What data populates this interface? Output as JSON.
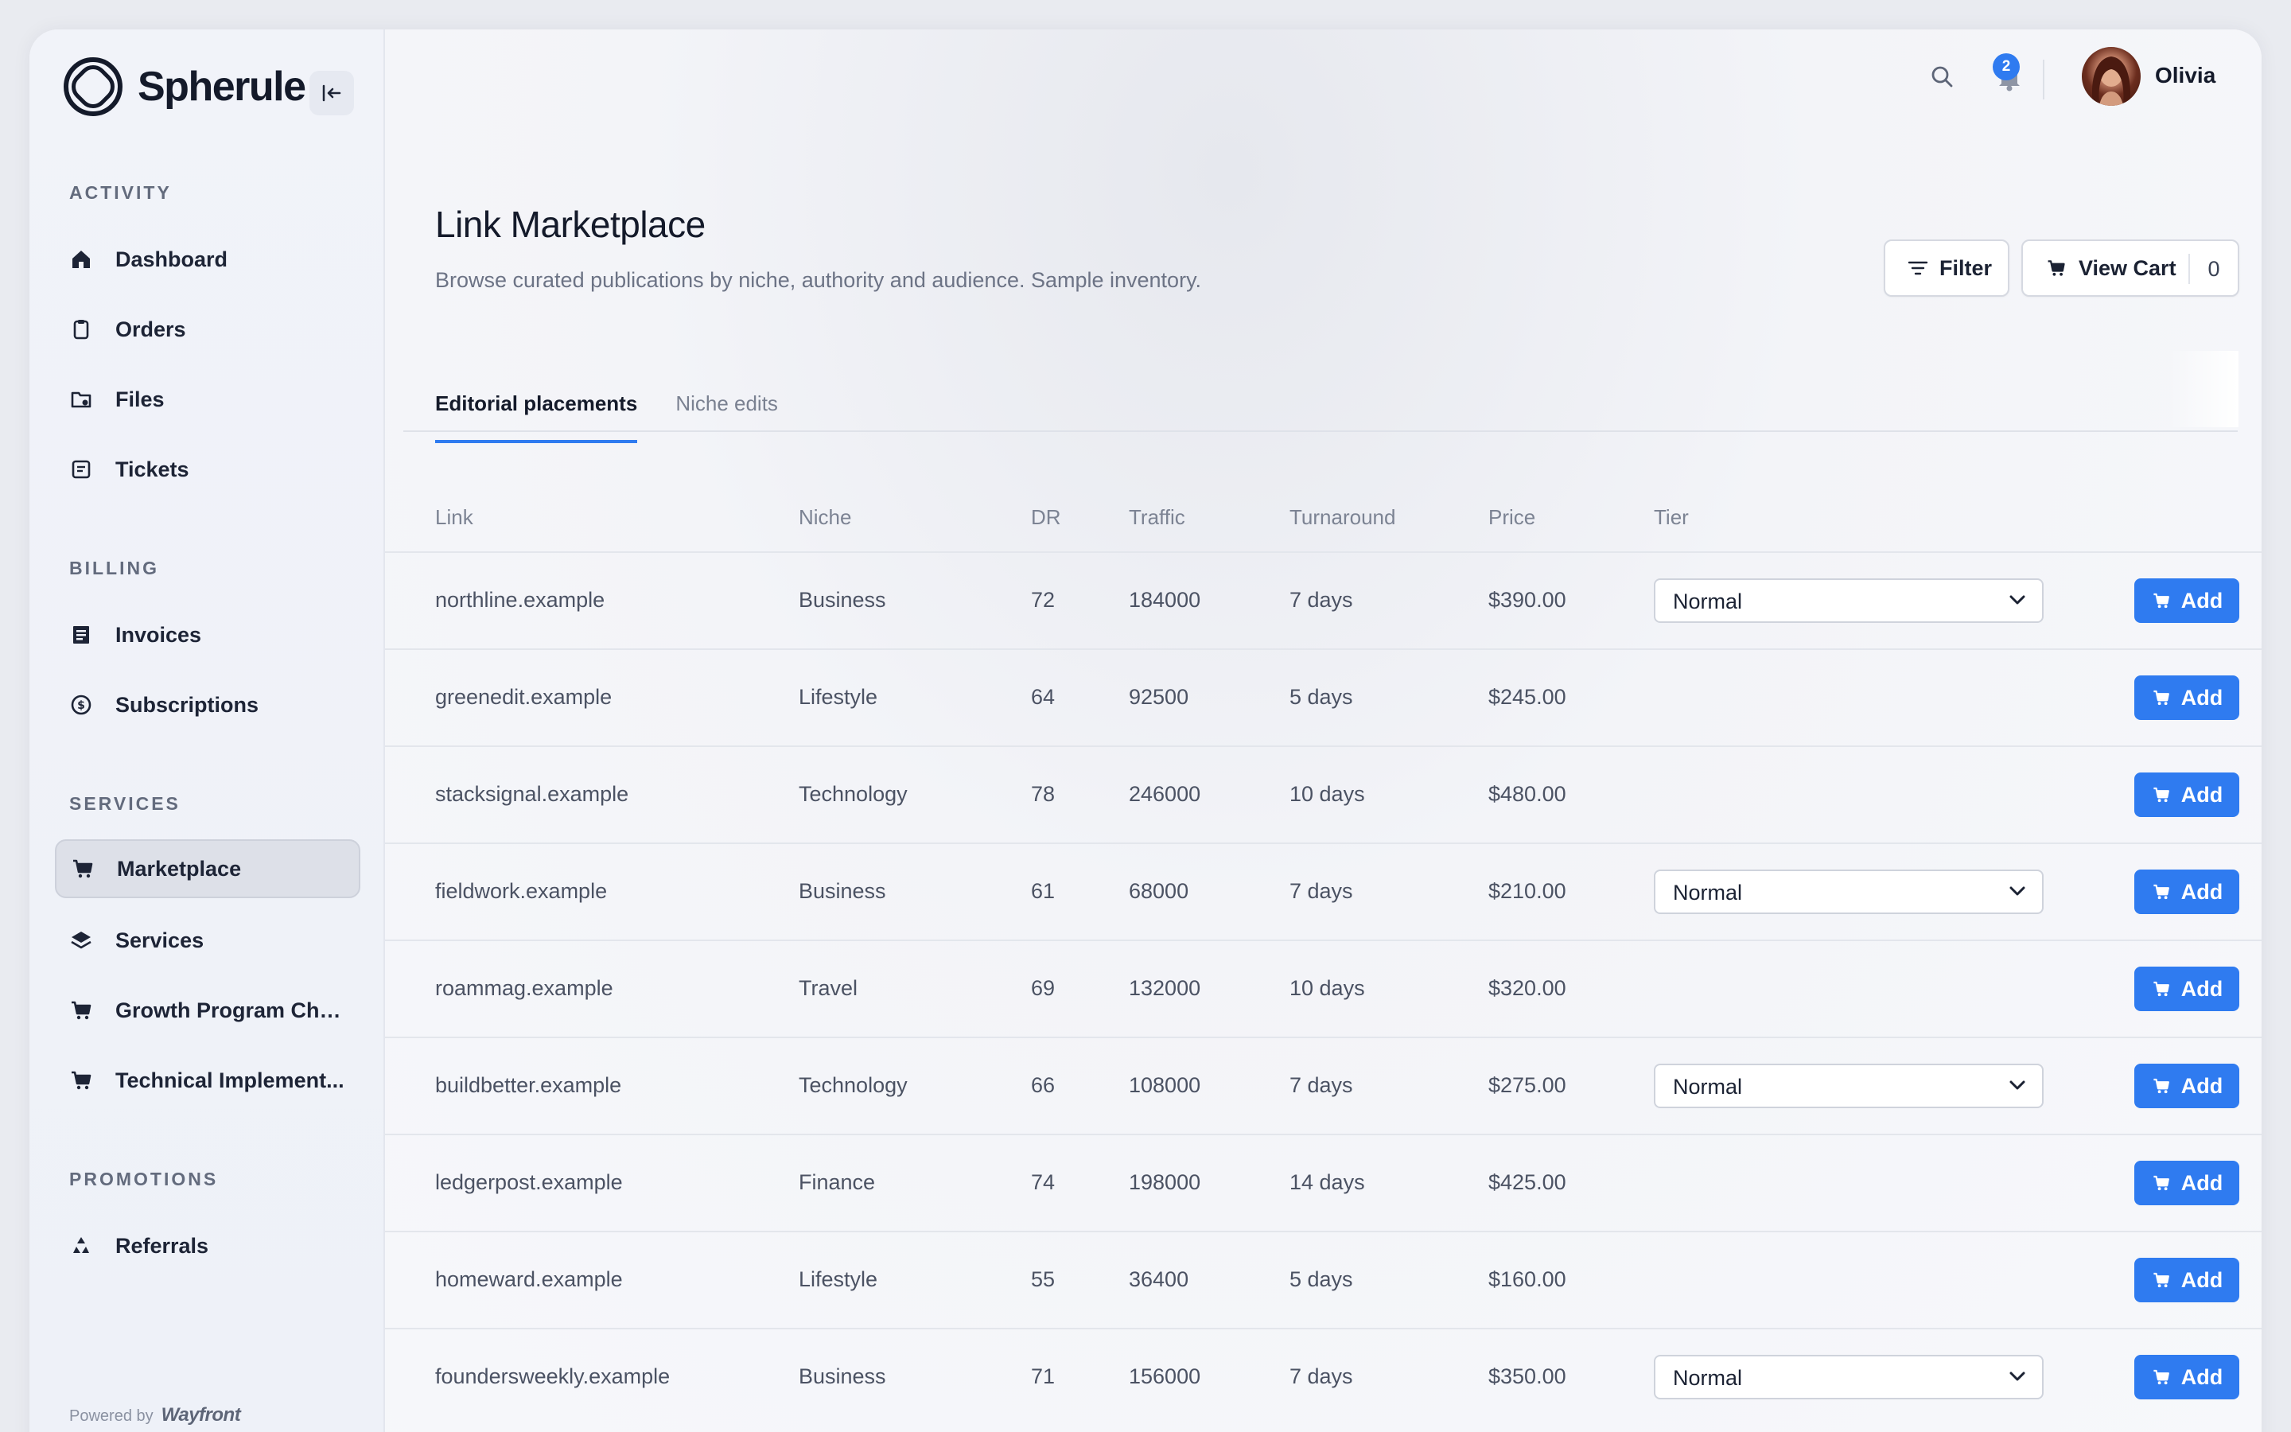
{
  "brand": {
    "name": "Spherule"
  },
  "sidebar": {
    "sections": [
      {
        "label": "ACTIVITY",
        "items": [
          {
            "label": "Dashboard",
            "icon": "home-icon"
          },
          {
            "label": "Orders",
            "icon": "clipboard-icon"
          },
          {
            "label": "Files",
            "icon": "folder-icon"
          },
          {
            "label": "Tickets",
            "icon": "ticket-icon"
          }
        ]
      },
      {
        "label": "BILLING",
        "items": [
          {
            "label": "Invoices",
            "icon": "invoice-icon"
          },
          {
            "label": "Subscriptions",
            "icon": "subscription-icon"
          }
        ]
      },
      {
        "label": "SERVICES",
        "items": [
          {
            "label": "Marketplace",
            "icon": "cart-icon",
            "active": true
          },
          {
            "label": "Services",
            "icon": "layers-icon"
          },
          {
            "label": "Growth Program Che...",
            "icon": "cart-icon"
          },
          {
            "label": "Technical Implement...",
            "icon": "cart-icon"
          }
        ]
      },
      {
        "label": "PROMOTIONS",
        "items": [
          {
            "label": "Referrals",
            "icon": "recycle-icon"
          }
        ]
      }
    ],
    "powered_by": "Powered by",
    "powered_brand": "Wayfront"
  },
  "topbar": {
    "notification_count": "2",
    "user_name": "Olivia"
  },
  "page": {
    "title": "Link Marketplace",
    "subtitle": "Browse curated publications by niche, authority and audience. Sample inventory.",
    "filter_label": "Filter",
    "view_cart_label": "View Cart",
    "cart_count": "0"
  },
  "tabs": [
    {
      "label": "Editorial placements",
      "active": true
    },
    {
      "label": "Niche edits",
      "active": false
    }
  ],
  "table": {
    "columns": [
      "Link",
      "Niche",
      "DR",
      "Traffic",
      "Turnaround",
      "Price",
      "Tier"
    ],
    "add_label": "Add",
    "rows": [
      {
        "link": "northline.example",
        "niche": "Business",
        "dr": "72",
        "traffic": "184000",
        "turnaround": "7 days",
        "price": "$390.00",
        "tier": "Normal"
      },
      {
        "link": "greenedit.example",
        "niche": "Lifestyle",
        "dr": "64",
        "traffic": "92500",
        "turnaround": "5 days",
        "price": "$245.00",
        "tier": ""
      },
      {
        "link": "stacksignal.example",
        "niche": "Technology",
        "dr": "78",
        "traffic": "246000",
        "turnaround": "10 days",
        "price": "$480.00",
        "tier": ""
      },
      {
        "link": "fieldwork.example",
        "niche": "Business",
        "dr": "61",
        "traffic": "68000",
        "turnaround": "7 days",
        "price": "$210.00",
        "tier": "Normal"
      },
      {
        "link": "roammag.example",
        "niche": "Travel",
        "dr": "69",
        "traffic": "132000",
        "turnaround": "10 days",
        "price": "$320.00",
        "tier": ""
      },
      {
        "link": "buildbetter.example",
        "niche": "Technology",
        "dr": "66",
        "traffic": "108000",
        "turnaround": "7 days",
        "price": "$275.00",
        "tier": "Normal"
      },
      {
        "link": "ledgerpost.example",
        "niche": "Finance",
        "dr": "74",
        "traffic": "198000",
        "turnaround": "14 days",
        "price": "$425.00",
        "tier": ""
      },
      {
        "link": "homeward.example",
        "niche": "Lifestyle",
        "dr": "55",
        "traffic": "36400",
        "turnaround": "5 days",
        "price": "$160.00",
        "tier": ""
      },
      {
        "link": "foundersweekly.example",
        "niche": "Business",
        "dr": "71",
        "traffic": "156000",
        "turnaround": "7 days",
        "price": "$350.00",
        "tier": "Normal"
      }
    ]
  },
  "colors": {
    "accent": "#2f7bf0",
    "text": "#1b2233",
    "muted": "#6c7385"
  }
}
